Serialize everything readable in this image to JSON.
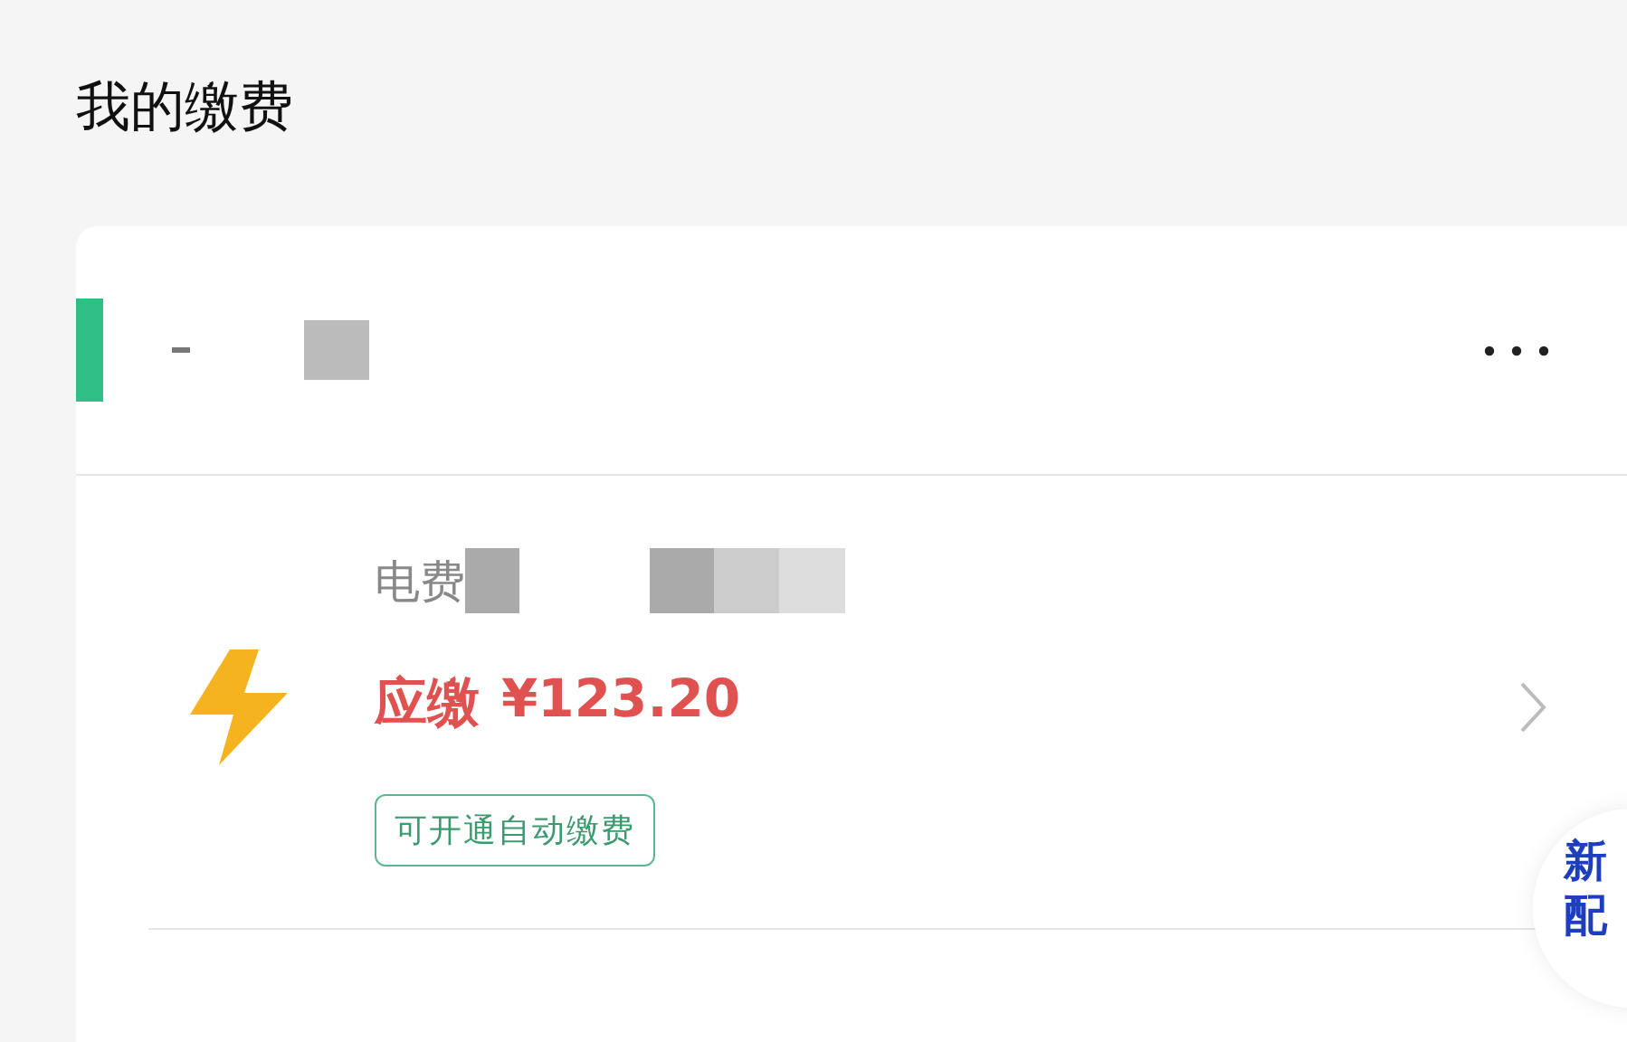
{
  "page_title": "我的缴费",
  "bill": {
    "name": "电费",
    "amount_label": "应缴",
    "amount": "¥123.20",
    "tag": "可开通自动缴费"
  },
  "floating_badge": {
    "lines": [
      "新",
      "配"
    ]
  }
}
